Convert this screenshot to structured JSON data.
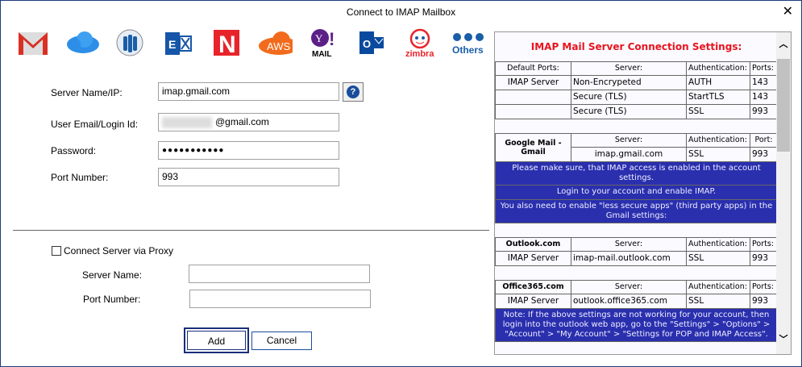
{
  "window": {
    "title": "Connect to IMAP Mailbox",
    "close": "✕"
  },
  "providers": [
    {
      "name": "gmail-icon",
      "label": "M",
      "color": "#d93025"
    },
    {
      "name": "icloud-icon",
      "label": "",
      "color": "#2d8ee8"
    },
    {
      "name": "lotus-notes-icon",
      "label": "",
      "color": "#1a5ea8"
    },
    {
      "name": "exchange-icon",
      "label": "E",
      "color": "#1656a8"
    },
    {
      "name": "novell-groupwise-icon",
      "label": "N",
      "color": "#e8242b"
    },
    {
      "name": "aws-icon",
      "label": "AWS",
      "color": "#f26b1d"
    },
    {
      "name": "yahoo-mail-icon",
      "label": "MAIL",
      "color": "#5c1f87"
    },
    {
      "name": "outlook-icon",
      "label": "O",
      "color": "#0a4a9e"
    },
    {
      "name": "zimbra-icon",
      "label": "zimbra",
      "color": "#e8242b"
    },
    {
      "name": "others-icon",
      "label": "Others",
      "color": "#1a5ea8"
    }
  ],
  "form": {
    "server_label": "Server Name/IP:",
    "server_value": "imap.gmail.com",
    "help": "?",
    "email_label": "User Email/Login Id:",
    "email_value": "@gmail.com",
    "password_label": "Password:",
    "password_value": "●●●●●●●●●●●",
    "port_label": "Port Number:",
    "port_value": "993"
  },
  "proxy": {
    "checkbox_label": "Connect Server via Proxy",
    "server_label": "Server Name:",
    "server_value": "",
    "port_label": "Port Number:",
    "port_value": ""
  },
  "buttons": {
    "add": "Add",
    "cancel": "Cancel"
  },
  "info": {
    "title": "IMAP Mail Server Connection Settings:",
    "default": {
      "headers": [
        "Default Ports:",
        "Server:",
        "Authentication:",
        "Ports:"
      ],
      "rows": [
        [
          "IMAP Server",
          "Non-Encrypeted",
          "AUTH",
          "143"
        ],
        [
          "",
          "Secure (TLS)",
          "StartTLS",
          "143"
        ],
        [
          "",
          "Secure (TLS)",
          "SSL",
          "993"
        ]
      ]
    },
    "gmail": {
      "name": "Google Mail - Gmail",
      "headers": [
        "Server:",
        "Authentication:",
        "Port:"
      ],
      "row": [
        "imap.gmail.com",
        "SSL",
        "993"
      ],
      "notes": [
        "Please make sure, that IMAP access is enabled in the account settings.",
        "Login to your account and enable IMAP.",
        "You also need to enable \"less secure apps\" (third party apps) in the Gmail settings:"
      ]
    },
    "outlook": {
      "name": "Outlook.com",
      "headers": [
        "Server:",
        "Authentication:",
        "Ports:"
      ],
      "row": [
        "IMAP Server",
        "imap-mail.outlook.com",
        "SSL",
        "993"
      ]
    },
    "office": {
      "name": "Office365.com",
      "headers": [
        "Server:",
        "Authentication:",
        "Ports:"
      ],
      "row": [
        "IMAP Server",
        "outlook.office365.com",
        "SSL",
        "993"
      ],
      "note": "Note: If the above settings are not working for your account, then login into the outlook web app, go to the \"Settings\" > \"Options\" > \"Account\" > \"My Account\" > \"Settings for POP and IMAP Access\"."
    }
  }
}
